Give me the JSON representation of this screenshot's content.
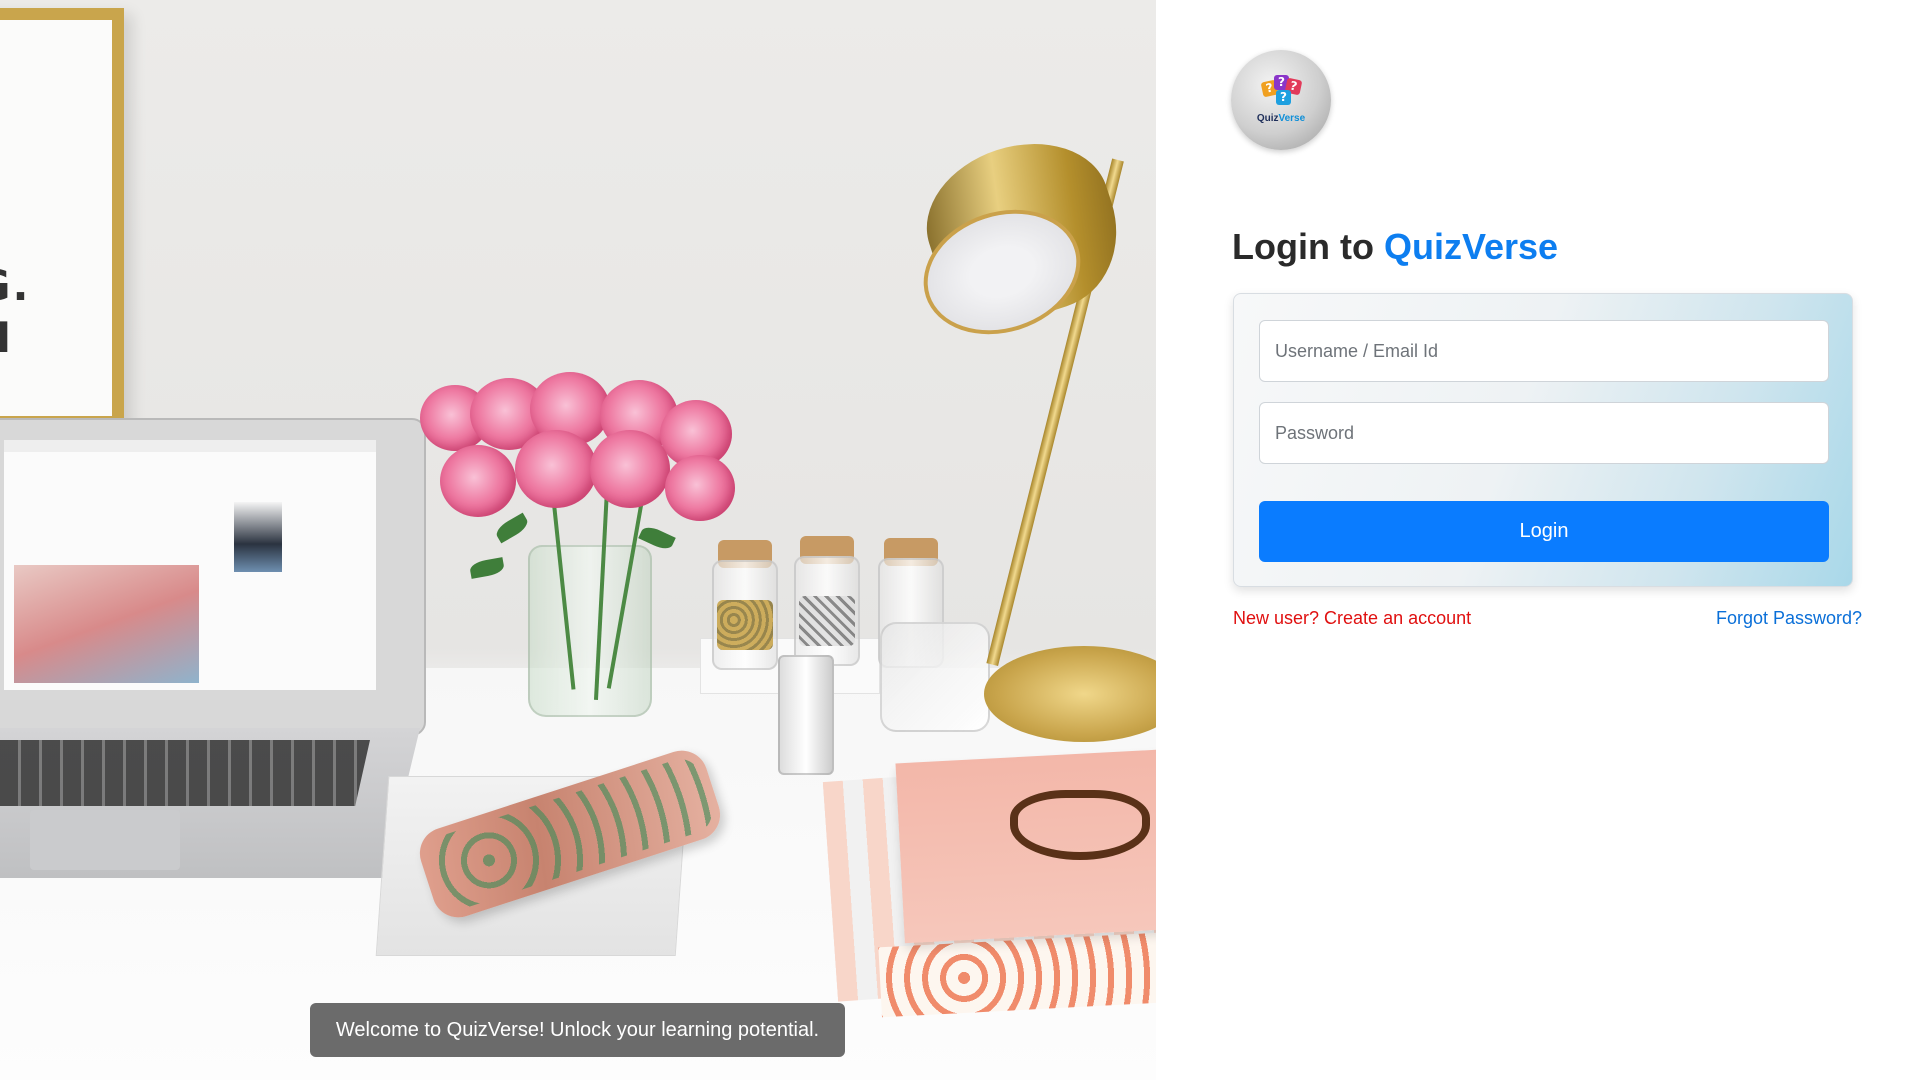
{
  "hero": {
    "welcome_text": "Welcome to QuizVerse! Unlock your learning potential."
  },
  "logo": {
    "name_part1": "Quiz",
    "name_part2": "Verse",
    "glyph1": "?",
    "glyph2": "?",
    "glyph3": "?",
    "glyph4": "?"
  },
  "login": {
    "title_prefix": "Login to ",
    "title_brand": "QuizVerse",
    "username_placeholder": "Username / Email Id",
    "password_placeholder": "Password",
    "login_button": "Login",
    "new_user_link": "New user? Create an account",
    "forgot_link": "Forgot Password?"
  },
  "colors": {
    "primary": "#0a7cff",
    "brand_text": "#0d7ef0",
    "error_link": "#e01010",
    "welcome_bg": "#5e5e5e"
  }
}
